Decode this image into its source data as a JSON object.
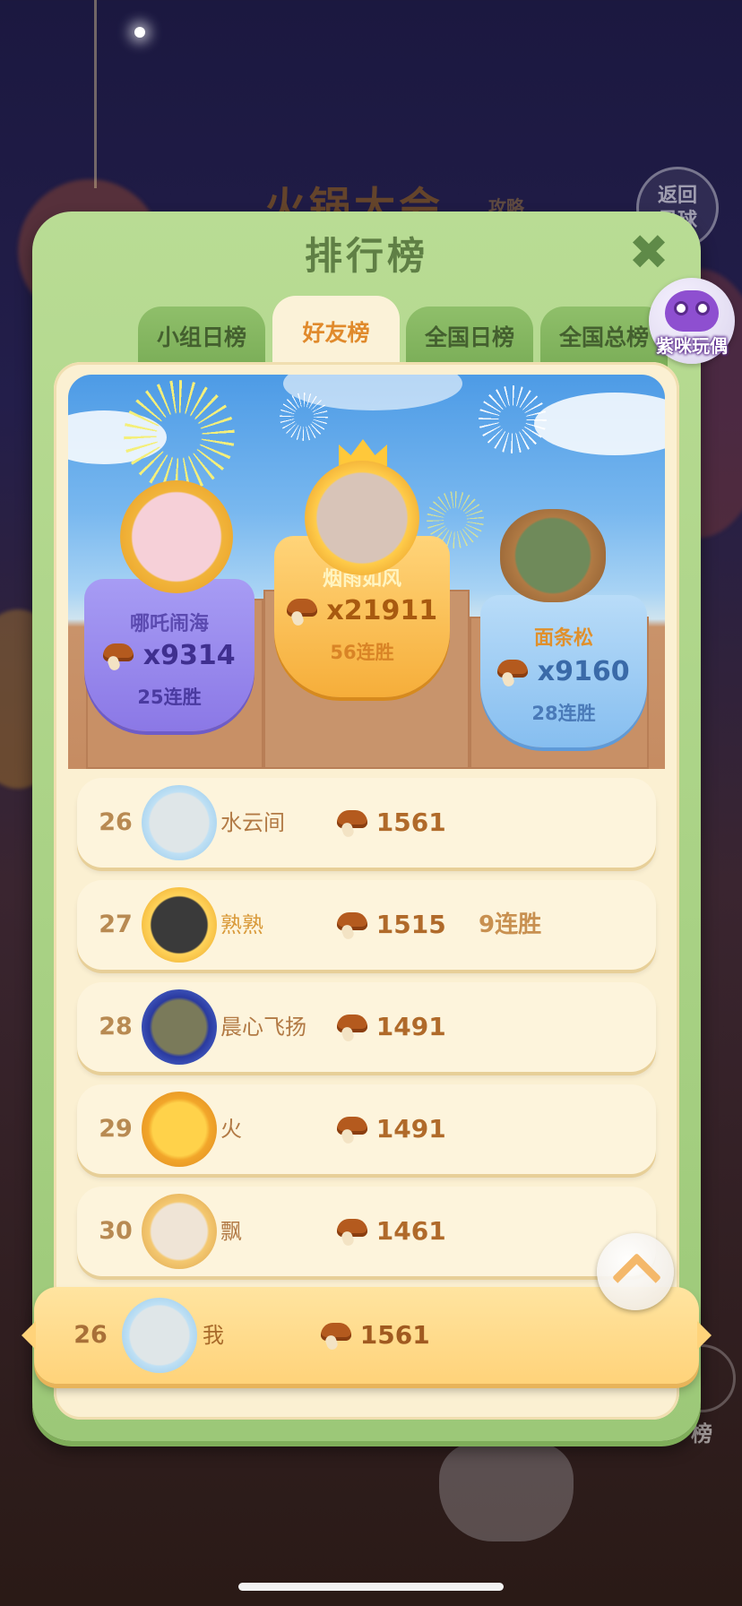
{
  "background": {
    "game_title": "火锅大会",
    "game_title_sub": "攻略",
    "back_button": "返回\n星球",
    "rank_button": "榜"
  },
  "modal": {
    "title": "排行榜",
    "tabs": [
      {
        "label": "小组日榜",
        "active": false
      },
      {
        "label": "好友榜",
        "active": true
      },
      {
        "label": "全国日榜",
        "active": false
      },
      {
        "label": "全国总榜",
        "active": false
      }
    ],
    "mascot_label": "紫咪玩偶"
  },
  "podium": {
    "first": {
      "name": "烟雨如风",
      "score": "x21911",
      "streak": "56连胜"
    },
    "second": {
      "name": "哪吒闹海",
      "score": "x9314",
      "streak": "25连胜"
    },
    "third": {
      "name": "面条松",
      "score": "x9160",
      "streak": "28连胜"
    }
  },
  "list": [
    {
      "rank": "26",
      "name": "水云间",
      "score": "1561",
      "streak": ""
    },
    {
      "rank": "27",
      "name": "熟熟",
      "score": "1515",
      "streak": "9连胜"
    },
    {
      "rank": "28",
      "name": "晨心飞扬",
      "score": "1491",
      "streak": ""
    },
    {
      "rank": "29",
      "name": "火",
      "score": "1491",
      "streak": ""
    },
    {
      "rank": "30",
      "name": "飘",
      "score": "1461",
      "streak": ""
    }
  ],
  "me": {
    "rank": "26",
    "name": "我",
    "score": "1561"
  },
  "colors": {
    "modal_green": "#b9dc94",
    "panel_cream": "#fbf0d2",
    "accent_orange": "#e08a2c"
  },
  "icons": [
    "close-icon",
    "mushroom-icon",
    "chevron-up-icon"
  ]
}
